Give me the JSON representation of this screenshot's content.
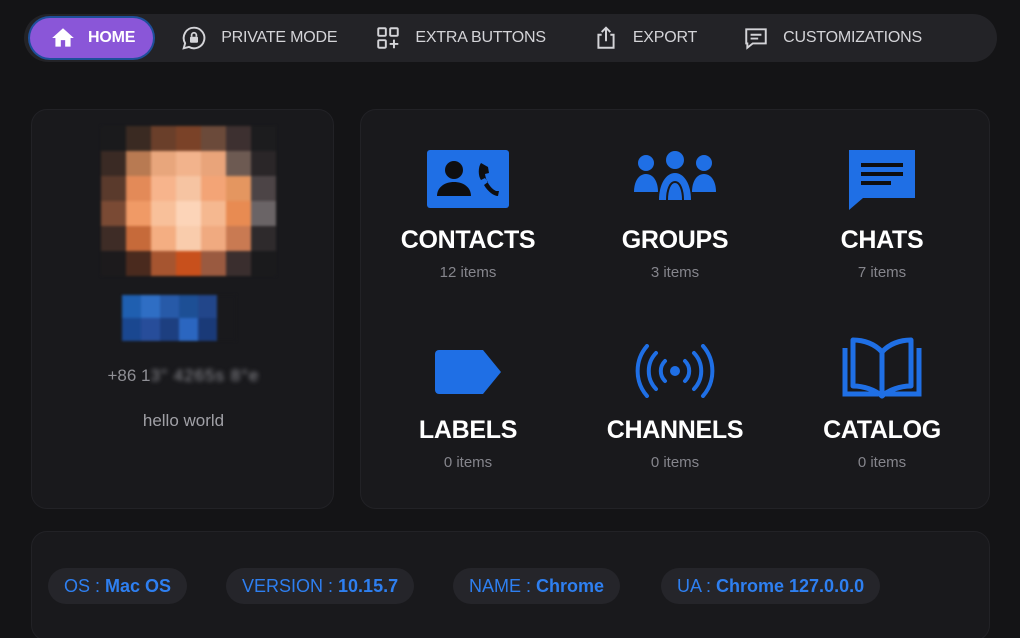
{
  "nav": {
    "home": "HOME",
    "private_mode": "PRIVATE MODE",
    "extra_buttons": "EXTRA BUTTONS",
    "export": "EXPORT",
    "customizations": "CUSTOMIZATIONS"
  },
  "profile": {
    "phone_prefix": "+86 1",
    "phone_hidden": "3\" 4265s 8°e",
    "status": "hello world"
  },
  "stats": [
    {
      "title": "CONTACTS",
      "count": "12 items",
      "icon": "contact-card-icon"
    },
    {
      "title": "GROUPS",
      "count": "3 items",
      "icon": "people-group-icon"
    },
    {
      "title": "CHATS",
      "count": "7 items",
      "icon": "chat-bubble-icon"
    },
    {
      "title": "LABELS",
      "count": "0 items",
      "icon": "label-tag-icon"
    },
    {
      "title": "CHANNELS",
      "count": "0 items",
      "icon": "broadcast-icon"
    },
    {
      "title": "CATALOG",
      "count": "0 items",
      "icon": "open-book-icon"
    }
  ],
  "info": {
    "os": {
      "key": "OS :",
      "value": "Mac OS"
    },
    "version": {
      "key": "VERSION :",
      "value": "10.15.7"
    },
    "name": {
      "key": "NAME :",
      "value": "Chrome"
    },
    "ua": {
      "key": "UA :",
      "value": "Chrome 127.0.0.0"
    }
  },
  "colors": {
    "accent_purple": "#8a56d8",
    "accent_blue": "#1f6fe5",
    "info_blue": "#2e7ff0",
    "background": "#141416",
    "card": "#19191c"
  }
}
